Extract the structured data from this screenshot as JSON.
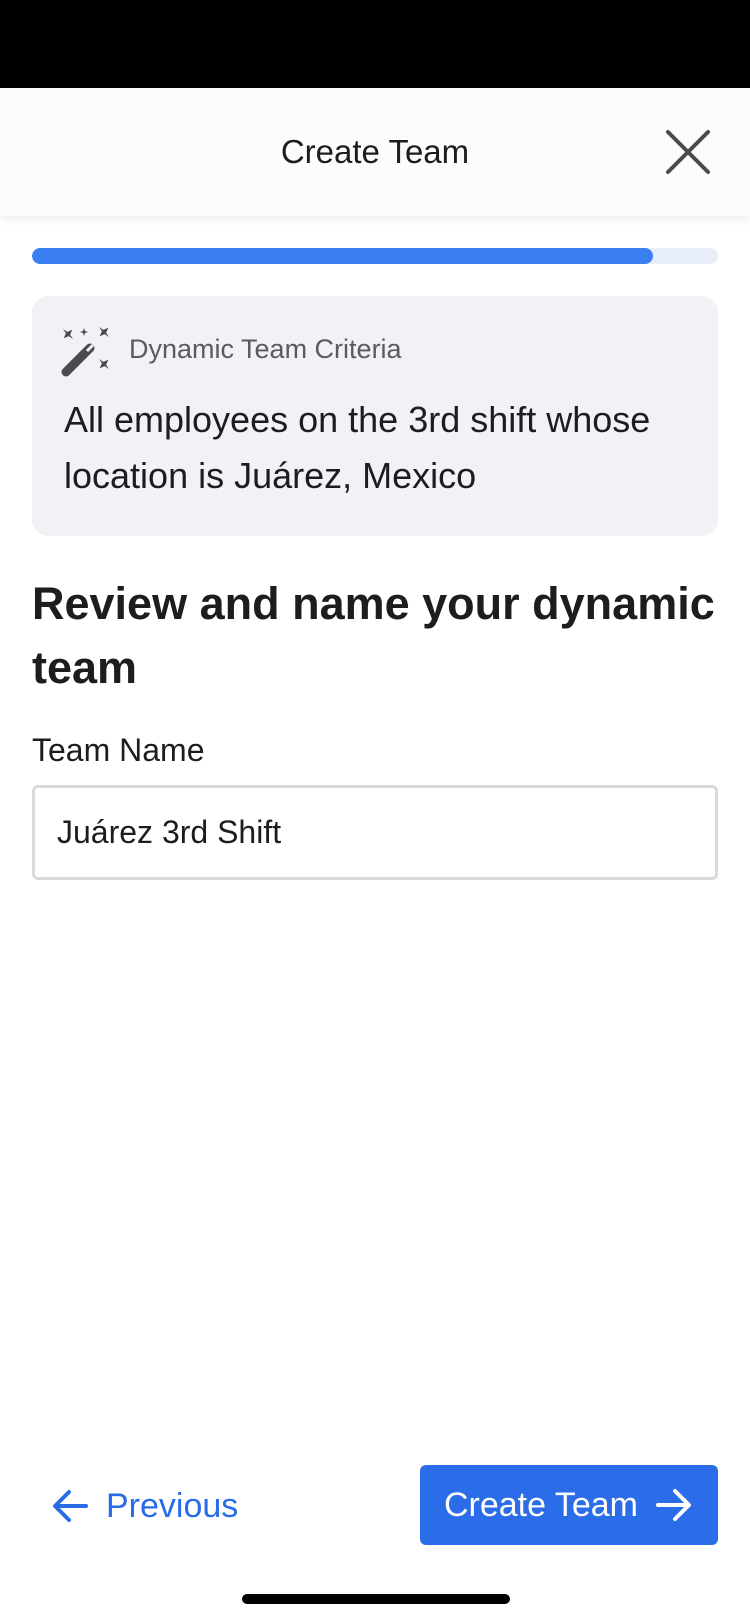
{
  "header": {
    "title": "Create Team",
    "close_icon": "close-icon"
  },
  "progress": {
    "value": 0.905,
    "fill_color": "#3b7ff0",
    "track_color": "#e8eef9"
  },
  "criteria": {
    "icon": "magic-wand-icon",
    "label": "Dynamic Team Criteria",
    "text": "All employees on the 3rd shift whose location is Juárez, Mexico"
  },
  "main": {
    "title": "Review and name your dynamic team",
    "team_name_label": "Team Name",
    "team_name_value": "Juárez 3rd Shift"
  },
  "footer": {
    "previous_label": "Previous",
    "previous_icon": "arrow-left-icon",
    "create_label": "Create Team",
    "create_icon": "arrow-right-icon",
    "accent_color": "#2b6de8"
  }
}
